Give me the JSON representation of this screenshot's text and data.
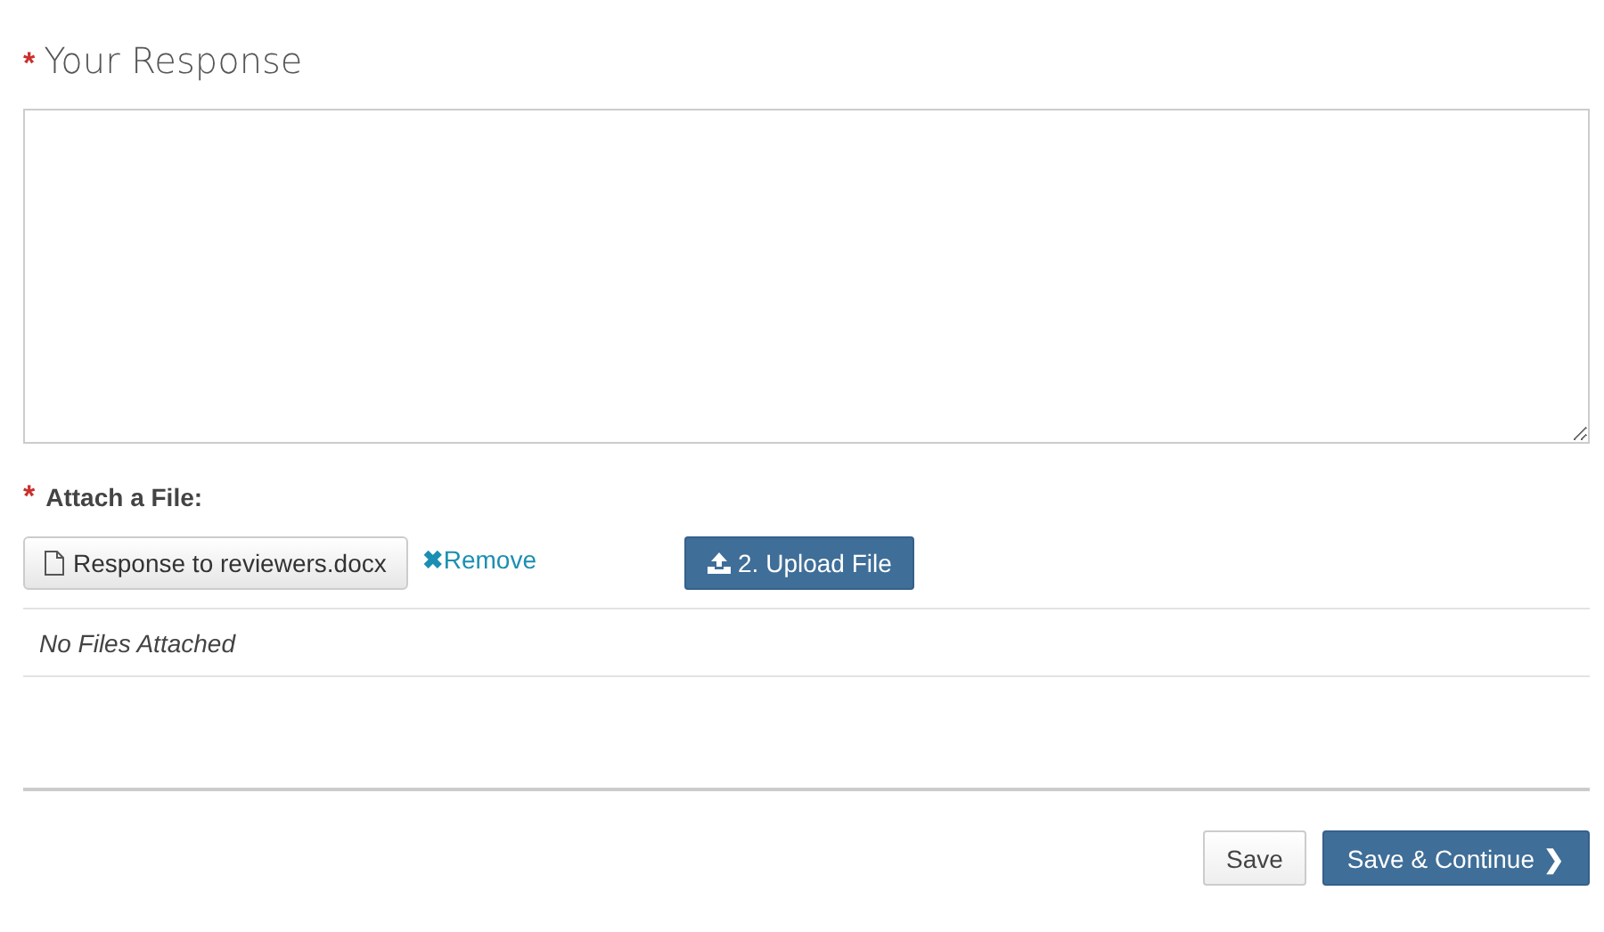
{
  "response": {
    "marker": "*",
    "label": "Your Response"
  },
  "attach": {
    "marker": "*",
    "label": "Attach a File:",
    "file_button": "Response to reviewers.docx",
    "remove_link": "Remove",
    "remove_icon": "✖",
    "upload_button": "2. Upload File"
  },
  "files": {
    "empty_message": "No Files Attached"
  },
  "buttons": [
    {
      "label": "Save",
      "kind": "default"
    },
    {
      "label": "Save & Continue",
      "kind": "primary",
      "icon": "❯"
    }
  ]
}
